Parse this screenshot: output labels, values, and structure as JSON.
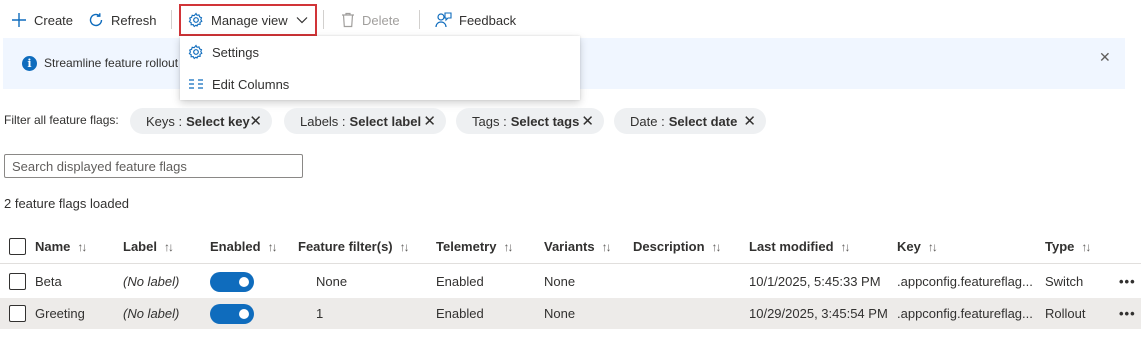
{
  "toolbar": {
    "create_label": "Create",
    "refresh_label": "Refresh",
    "manage_view_label": "Manage view",
    "delete_label": "Delete",
    "feedback_label": "Feedback"
  },
  "menu": {
    "items": [
      {
        "label": "Settings",
        "icon": "gear-icon"
      },
      {
        "label": "Edit Columns",
        "icon": "columns-icon"
      }
    ]
  },
  "banner": {
    "text": "Streamline feature rollout"
  },
  "filters": {
    "label": "Filter all feature flags:",
    "pills": [
      {
        "name": "Keys :",
        "value": "Select key"
      },
      {
        "name": "Labels :",
        "value": "Select label"
      },
      {
        "name": "Tags :",
        "value": "Select tags"
      },
      {
        "name": "Date :",
        "value": "Select date"
      }
    ]
  },
  "search": {
    "placeholder": "Search displayed feature flags"
  },
  "status": {
    "loaded_text": "2 feature flags loaded"
  },
  "table": {
    "columns": [
      "Name",
      "Label",
      "Enabled",
      "Feature filter(s)",
      "Telemetry",
      "Variants",
      "Description",
      "Last modified",
      "Key",
      "Type"
    ],
    "rows": [
      {
        "name": "Beta",
        "label": "(No label)",
        "enabled": true,
        "filters": "None",
        "telemetry": "Enabled",
        "variants": "None",
        "description": "",
        "last_modified": "10/1/2025, 5:45:33 PM",
        "key": ".appconfig.featureflag...",
        "type": "Switch"
      },
      {
        "name": "Greeting",
        "label": "(No label)",
        "enabled": true,
        "filters": "1",
        "telemetry": "Enabled",
        "variants": "None",
        "description": "",
        "last_modified": "10/29/2025, 3:45:54 PM",
        "key": ".appconfig.featureflag...",
        "type": "Rollout"
      }
    ]
  },
  "colors": {
    "accent": "#0f6cbd",
    "highlight_border": "#d13438",
    "banner_bg": "#f0f6ff"
  }
}
